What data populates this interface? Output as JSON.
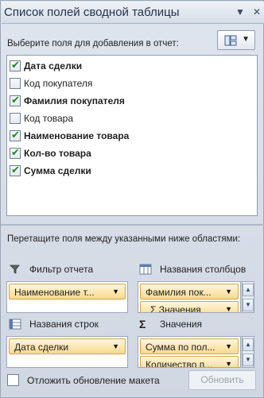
{
  "window": {
    "title": "Список полей сводной таблицы",
    "menu_icon": "dropdown-arrow-icon",
    "close_icon": "close-icon"
  },
  "fields_section": {
    "label": "Выберите поля для добавления в отчет:",
    "layout_button_icon": "layout-options-icon",
    "fields": [
      {
        "name": "Дата  сделки",
        "checked": true
      },
      {
        "name": "Код покупателя",
        "checked": false
      },
      {
        "name": "Фамилия покупателя",
        "checked": true
      },
      {
        "name": "Код товара",
        "checked": false
      },
      {
        "name": "Наименование товара",
        "checked": true
      },
      {
        "name": "Кол-во товара",
        "checked": true
      },
      {
        "name": "Сумма сделки",
        "checked": true
      }
    ]
  },
  "areas": {
    "hint": "Перетащите поля между указанными ниже областями:",
    "report_filter": {
      "label": "Фильтр отчета",
      "icon": "filter-icon",
      "items": [
        "Наименование т..."
      ]
    },
    "column_labels": {
      "label": "Названия столбцов",
      "icon": "columns-icon",
      "items": [
        "Фамилия пок...",
        "Σ  Значения"
      ]
    },
    "row_labels": {
      "label": "Названия строк",
      "icon": "rows-icon",
      "items": [
        "Дата  сделки"
      ]
    },
    "values": {
      "label": "Значения",
      "icon": "sigma-icon",
      "items": [
        "Сумма по пол...",
        "Количество п..."
      ]
    }
  },
  "footer": {
    "defer_label": "Отложить обновление макета",
    "defer_checked": false,
    "update_button": "Обновить"
  },
  "colors": {
    "chip_fill": "#f8d98e",
    "chip_border": "#d6a24a",
    "check": "#1f8a1f"
  }
}
